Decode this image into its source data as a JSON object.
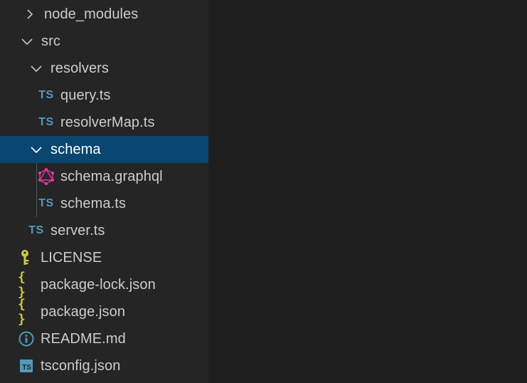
{
  "explorer": {
    "items": [
      {
        "label": "node_modules",
        "icon": "chevron-right-icon",
        "kind": "folder",
        "expanded": false
      },
      {
        "label": "src",
        "icon": "chevron-down-icon",
        "kind": "folder",
        "expanded": true
      },
      {
        "label": "resolvers",
        "icon": "chevron-down-icon",
        "kind": "folder",
        "expanded": true
      },
      {
        "label": "query.ts",
        "icon": "typescript-icon",
        "icon_text": "TS",
        "kind": "file"
      },
      {
        "label": "resolverMap.ts",
        "icon": "typescript-icon",
        "icon_text": "TS",
        "kind": "file"
      },
      {
        "label": "schema",
        "icon": "chevron-down-icon",
        "kind": "folder",
        "expanded": true,
        "selected": true
      },
      {
        "label": "schema.graphql",
        "icon": "graphql-icon",
        "kind": "file"
      },
      {
        "label": "schema.ts",
        "icon": "typescript-icon",
        "icon_text": "TS",
        "kind": "file"
      },
      {
        "label": "server.ts",
        "icon": "typescript-icon",
        "icon_text": "TS",
        "kind": "file"
      },
      {
        "label": "LICENSE",
        "icon": "key-icon",
        "kind": "file"
      },
      {
        "label": "package-lock.json",
        "icon": "json-icon",
        "icon_text": "{ }",
        "kind": "file"
      },
      {
        "label": "package.json",
        "icon": "json-icon",
        "icon_text": "{ }",
        "kind": "file"
      },
      {
        "label": "README.md",
        "icon": "info-icon",
        "kind": "file"
      },
      {
        "label": "tsconfig.json",
        "icon": "tsconfig-icon",
        "icon_text": "TS",
        "kind": "file"
      }
    ]
  },
  "colors": {
    "sidebar_bg": "#252526",
    "editor_bg": "#1e1e1e",
    "selection_bg": "#094771",
    "text": "#cccccc",
    "ts_blue": "#519aba",
    "json_yellow": "#cbcb41",
    "graphql_pink": "#e535ab",
    "license_yellow": "#cbcb41",
    "info_blue": "#519aba"
  }
}
